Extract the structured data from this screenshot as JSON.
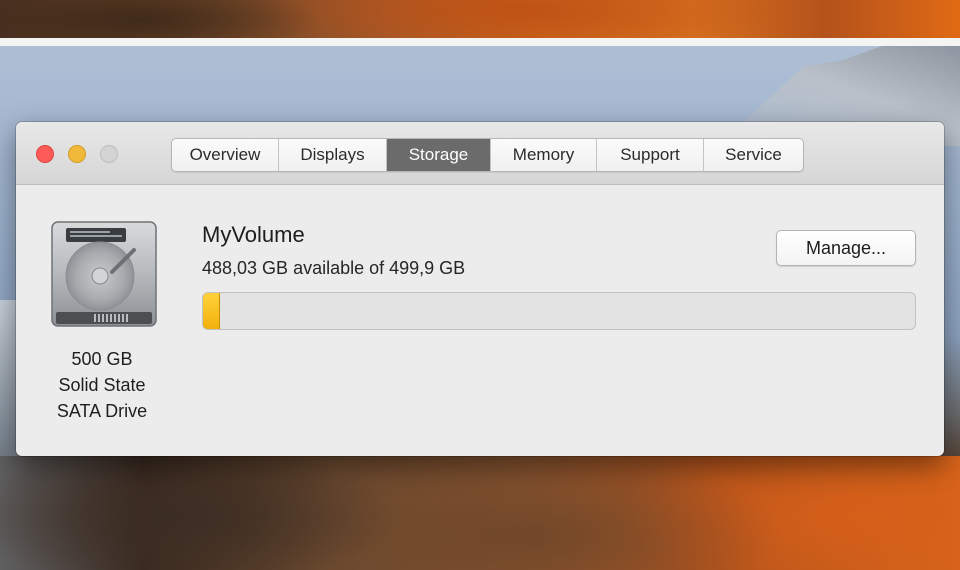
{
  "window": {
    "tabs": [
      {
        "label": "Overview",
        "active": false
      },
      {
        "label": "Displays",
        "active": false
      },
      {
        "label": "Storage",
        "active": true
      },
      {
        "label": "Memory",
        "active": false
      },
      {
        "label": "Support",
        "active": false
      },
      {
        "label": "Service",
        "active": false
      }
    ]
  },
  "drive": {
    "icon": "hard-drive-icon",
    "capacity": "500 GB",
    "type_line1": "Solid State",
    "type_line2": "SATA Drive"
  },
  "volume": {
    "name": "MyVolume",
    "space": "488,03 GB available of 499,9 GB",
    "used_fraction": 0.024,
    "manage_label": "Manage..."
  },
  "colors": {
    "used_storage": "#f2b10c",
    "active_tab": "#6b6b6b",
    "close": "#fc5b57",
    "minimize": "#f0b93a"
  }
}
